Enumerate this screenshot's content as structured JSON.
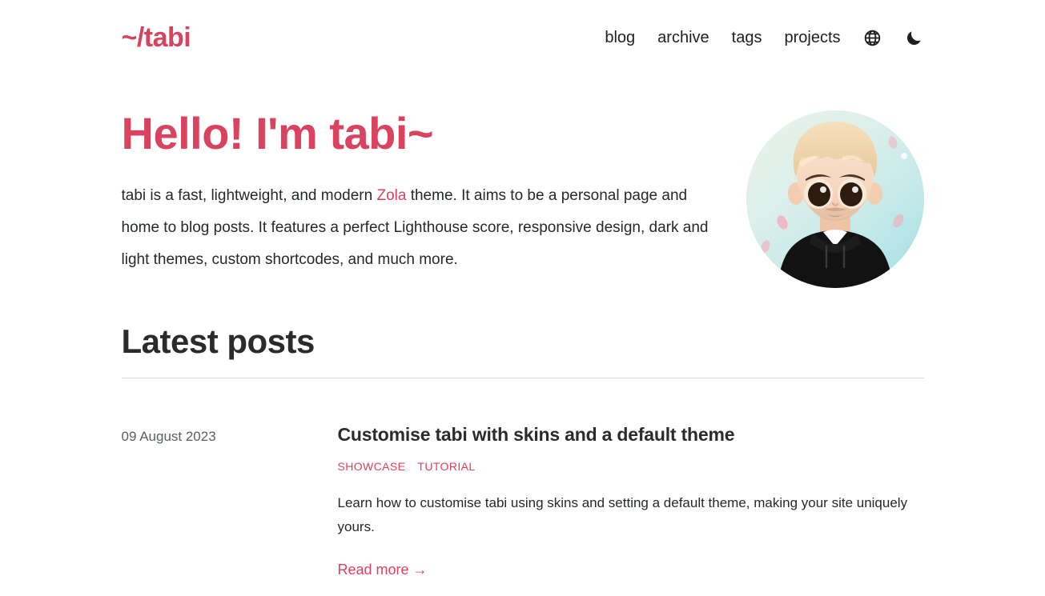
{
  "site": {
    "logo": "~/tabi",
    "brand_color": "#d9435f",
    "text_color": "#25282b"
  },
  "nav": {
    "links": [
      {
        "label": "blog"
      },
      {
        "label": "archive"
      },
      {
        "label": "tags"
      },
      {
        "label": "projects"
      }
    ],
    "icons": [
      {
        "name": "globe-icon",
        "title": "Change language"
      },
      {
        "name": "moon-icon",
        "title": "Toggle dark mode"
      }
    ]
  },
  "hero": {
    "title": "Hello! I'm tabi~",
    "desc_before": "tabi is a fast, lightweight, and modern ",
    "desc_link": "Zola",
    "desc_after": " theme. It aims to be a personal page and home to blog posts. It features a perfect Lighthouse score, responsive design, dark and light themes, custom shortcodes, and much more.",
    "avatar_alt": "Cartoon avatar of a blonde person in a black hoodie"
  },
  "latest_posts": {
    "heading": "Latest posts",
    "posts": [
      {
        "date": "09 August 2023",
        "title": "Customise tabi with skins and a default theme",
        "tags": [
          "SHOWCASE",
          "TUTORIAL"
        ],
        "description": "Learn how to customise tabi using skins and setting a default theme, making your site uniquely yours.",
        "read_more": "Read more",
        "read_more_arrow": "→"
      }
    ]
  }
}
